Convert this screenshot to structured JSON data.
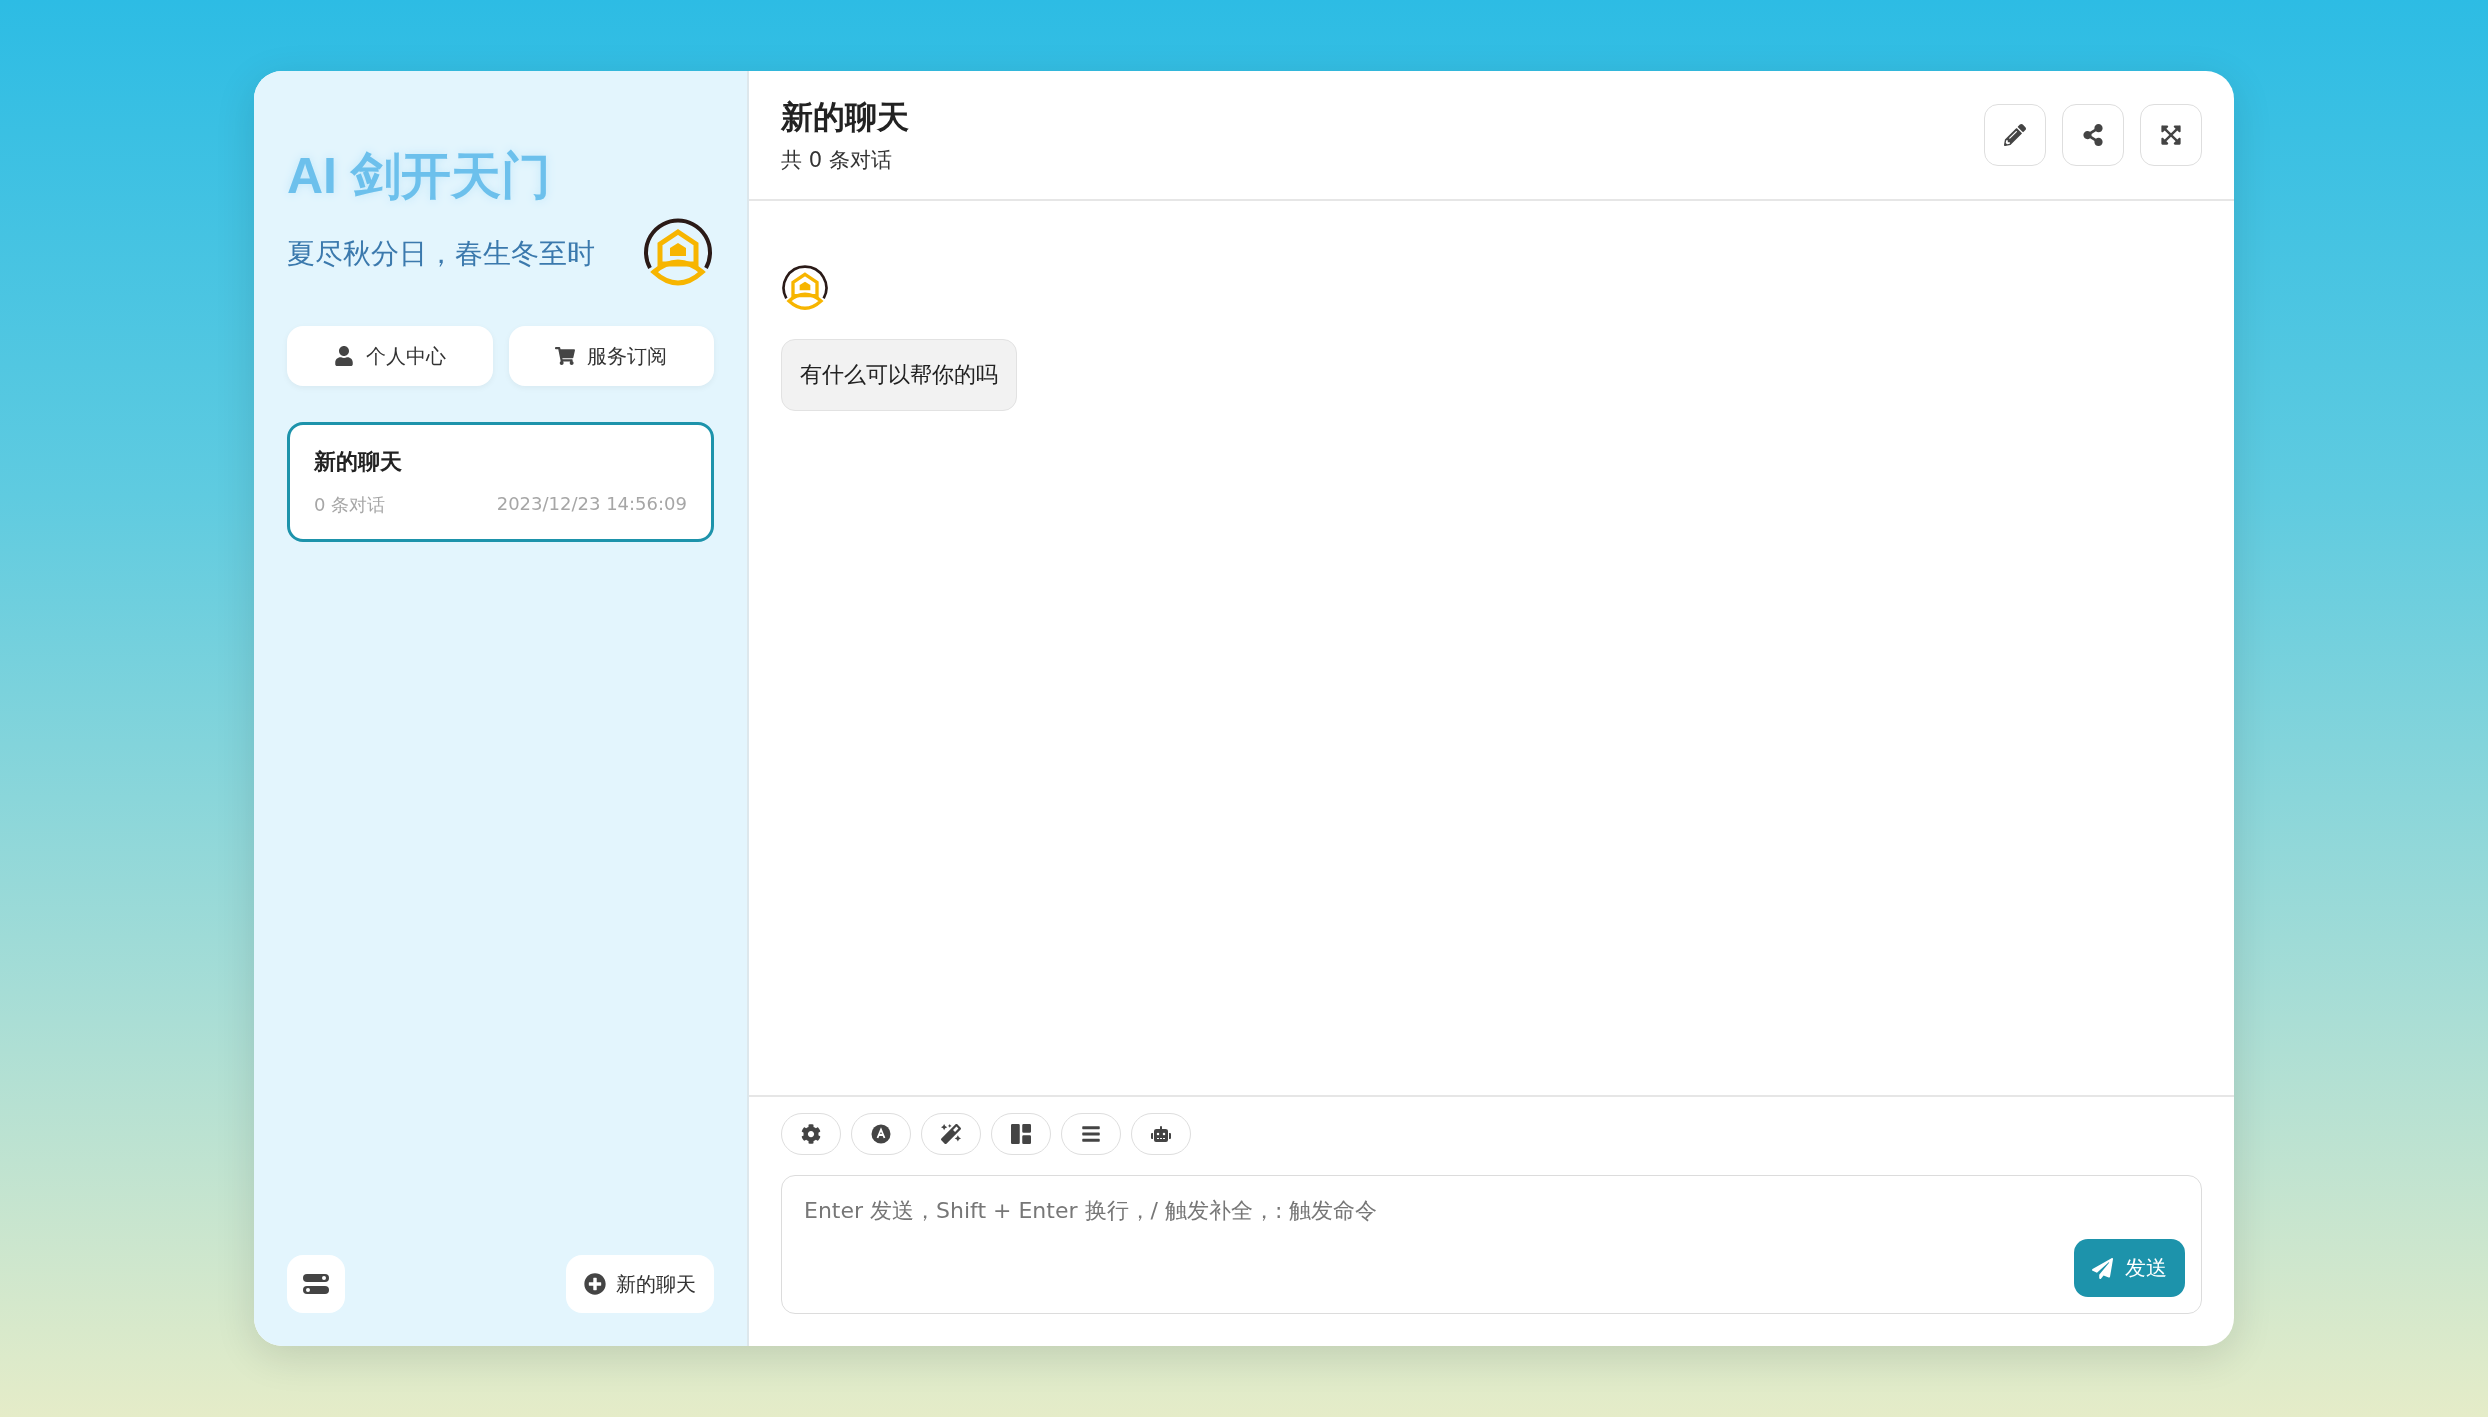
{
  "sidebar": {
    "title": "AI 剑开天门",
    "subtitle": "夏尽秋分日，春生冬至时",
    "buttons": [
      {
        "kind": "user",
        "label": "个人中心"
      },
      {
        "kind": "cart",
        "label": "服务订阅"
      }
    ],
    "sessions": [
      {
        "title": "新的聊天",
        "count": "0 条对话",
        "time": "2023/12/23 14:56:09",
        "selected": true
      }
    ],
    "new_chat": "新的聊天"
  },
  "chat": {
    "title": "新的聊天",
    "subtitle": "共 0 条对话",
    "actions": [
      {
        "kind": "edit"
      },
      {
        "kind": "share"
      },
      {
        "kind": "fullscreen"
      }
    ],
    "messages": [
      {
        "kind": "bot",
        "text": "有什么可以帮你的吗"
      }
    ],
    "tools": [
      {
        "kind": "settings"
      },
      {
        "kind": "prompt"
      },
      {
        "kind": "mask"
      },
      {
        "kind": "apps"
      },
      {
        "kind": "stack"
      },
      {
        "kind": "robot"
      }
    ],
    "input": {
      "placeholder": "Enter 发送，Shift + Enter 换行，/ 触发补全，: 触发命令"
    },
    "send": "发送"
  }
}
